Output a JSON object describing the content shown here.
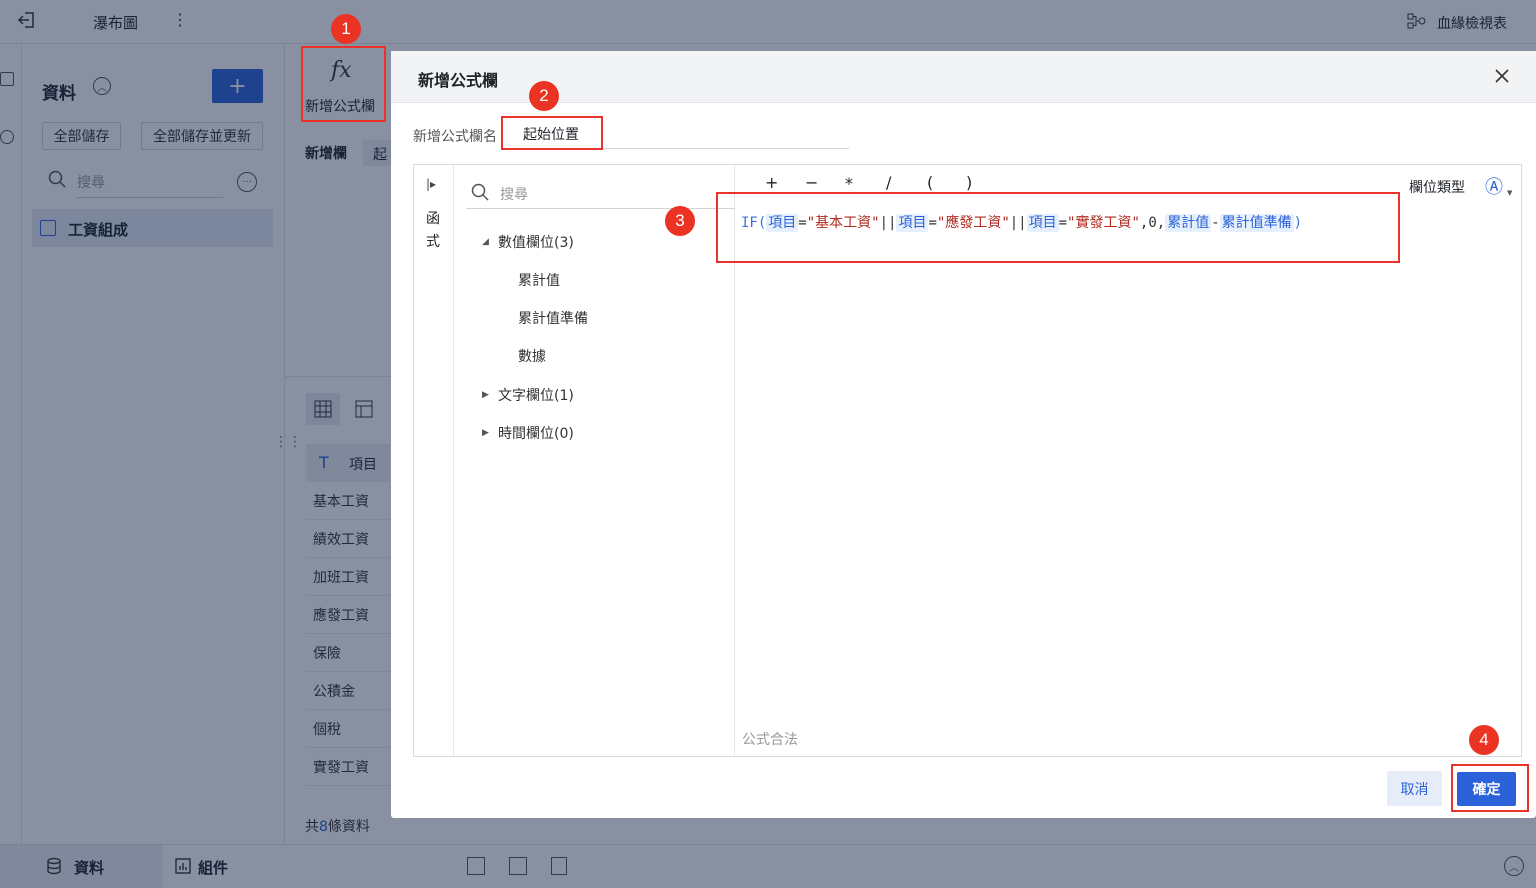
{
  "topbar": {
    "title": "瀑布圖",
    "lineage_label": "血緣檢視表"
  },
  "data_panel": {
    "title": "資料",
    "add_button": "+",
    "save_all": "全部儲存",
    "save_all_update": "全部儲存並更新",
    "search_placeholder": "搜尋",
    "table_name": "工資組成"
  },
  "toolbar": {
    "add_formula_label": "新增公式欄",
    "fx_glyph": "fx"
  },
  "main": {
    "new_column_label": "新增欄",
    "new_column_tag": "起",
    "column_header": "項目",
    "rows": [
      "基本工資",
      "績效工資",
      "加班工資",
      "應發工資",
      "保險",
      "公積金",
      "個稅",
      "實發工資"
    ],
    "count_prefix": "共",
    "count": "8",
    "count_suffix": "條資料"
  },
  "bottom": {
    "tab_data": "資料",
    "tab_component": "組件"
  },
  "dialog": {
    "title": "新增公式欄",
    "name_label": "新增公式欄名",
    "name_value": "起始位置",
    "functions_tab": [
      "函",
      "式"
    ],
    "search_placeholder": "搜尋",
    "groups": [
      {
        "label": "數值欄位(3)",
        "expanded": true,
        "fields": [
          "累計值",
          "累計值準備",
          "數據"
        ]
      },
      {
        "label": "文字欄位(1)",
        "expanded": false,
        "fields": []
      },
      {
        "label": "時間欄位(0)",
        "expanded": false,
        "fields": []
      }
    ],
    "operators": [
      "+",
      "−",
      "*",
      "/",
      "(",
      ")"
    ],
    "field_type_label": "欄位類型",
    "field_type_icon": "Ⓐ",
    "formula": {
      "fn": "IF(",
      "field1": "項目",
      "eq1": "=",
      "str1": "\"基本工資\"",
      "or1": "||",
      "field2": "項目",
      "eq2": "=",
      "str2": "\"應發工資\"",
      "or2": "||",
      "field3": "項目",
      "eq3": "=",
      "str3": "\"實發工資\"",
      "comma_zero": ",0,",
      "field4": "累計值",
      "minus": "-",
      "field5": "累計值準備",
      "close": ")"
    },
    "status": "公式合法",
    "cancel": "取消",
    "confirm": "確定"
  },
  "callouts": [
    "1",
    "2",
    "3",
    "4"
  ],
  "colors": {
    "accent": "#2b62d9",
    "callout": "#ea3323",
    "highlight_box": "#e8322a"
  }
}
